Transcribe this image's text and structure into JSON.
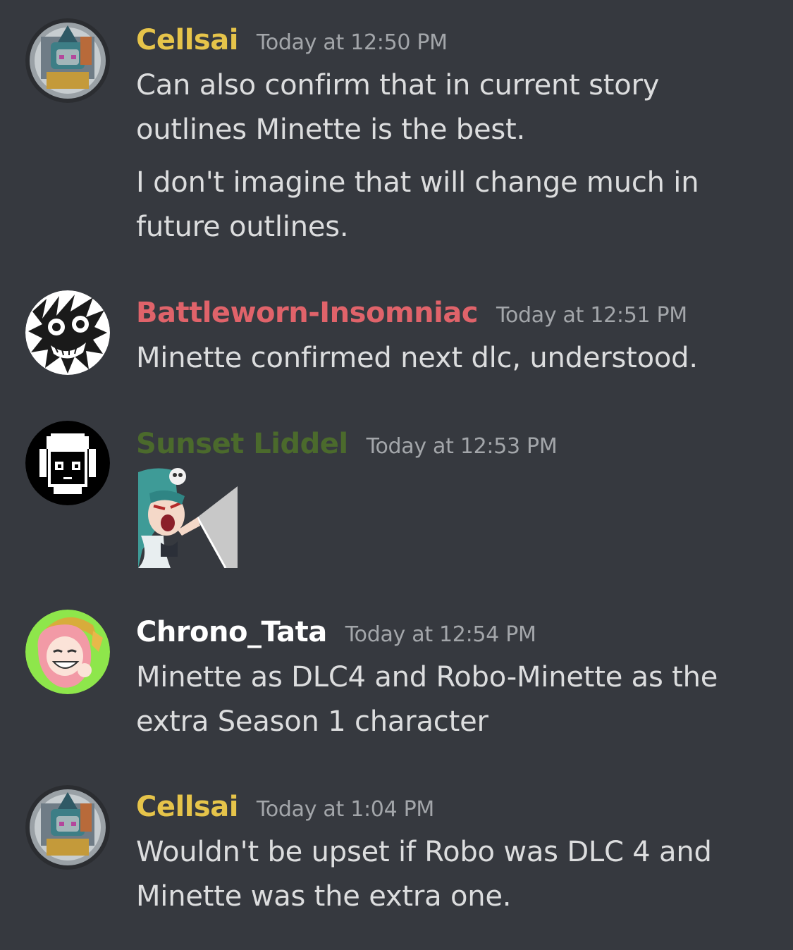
{
  "colors": {
    "background": "#36393f",
    "text": "#dcddde",
    "timestamp": "#a3a6aa"
  },
  "messages": [
    {
      "username": "Cellsai",
      "username_color": "#e6c44a",
      "timestamp": "Today at 12:50 PM",
      "lines": [
        "Can also confirm that in current story outlines Minette is the best.",
        "I don't imagine that will change much in future outlines."
      ]
    },
    {
      "username": "Battleworn-Insomniac",
      "username_color": "#e0636a",
      "timestamp": "Today at 12:51 PM",
      "lines": [
        "Minette confirmed next dlc, understood."
      ]
    },
    {
      "username": "Sunset Liddel",
      "username_color": "#4b6a2c",
      "timestamp": "Today at 12:53 PM",
      "sticker": "minette-screaming-sticker"
    },
    {
      "username": "Chrono_Tata",
      "username_color": "#ffffff",
      "timestamp": "Today at 12:54 PM",
      "lines": [
        "Minette as DLC4 and Robo-Minette as the extra Season 1 character"
      ]
    },
    {
      "username": "Cellsai",
      "username_color": "#e6c44a",
      "timestamp": "Today at 1:04 PM",
      "lines": [
        "Wouldn't be upset if Robo was DLC 4 and Minette was the extra one."
      ]
    }
  ]
}
